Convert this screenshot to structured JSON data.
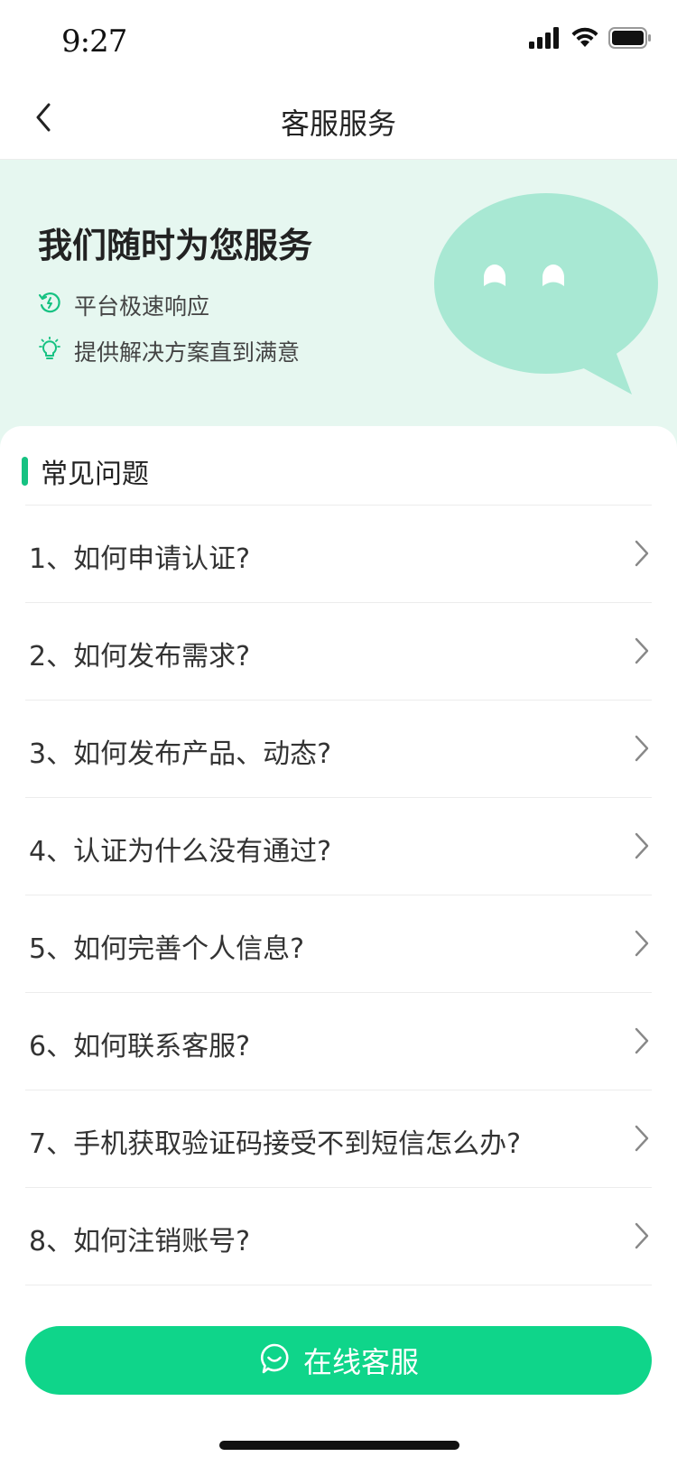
{
  "status_bar": {
    "time": "9:27",
    "icons": [
      "signal-icon",
      "wifi-icon",
      "battery-icon"
    ]
  },
  "nav": {
    "title": "客服服务",
    "back_icon": "chevron-left-icon"
  },
  "hero": {
    "title": "我们随时为您服务",
    "features": [
      {
        "icon": "clock-refresh-icon",
        "text": "平台极速响应"
      },
      {
        "icon": "lightbulb-icon",
        "text": "提供解决方案直到满意"
      }
    ],
    "illustration": "chat-bubble-illustration"
  },
  "faq": {
    "title": "常见问题",
    "items": [
      "1、如何申请认证?",
      "2、如何发布需求?",
      "3、如何发布产品、动态?",
      "4、认证为什么没有通过?",
      "5、如何完善个人信息?",
      "6、如何联系客服?",
      "7、手机获取验证码接受不到短信怎么办?",
      "8、如何注销账号?"
    ]
  },
  "cta": {
    "label": "在线客服",
    "icon": "smile-chat-icon"
  },
  "colors": {
    "accent": "#16c282",
    "button": "#0fd58a",
    "hero_bg": "#e6f7f0",
    "bubble": "#a8e8d3"
  }
}
